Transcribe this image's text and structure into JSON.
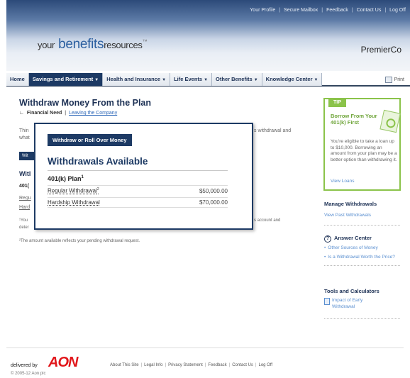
{
  "top_nav": [
    "Your Profile",
    "Secure Mailbox",
    "Feedback",
    "Contact Us",
    "Log Off"
  ],
  "logo": {
    "your": "your",
    "benefits": "benefits",
    "resources": "resources",
    "tm": "™"
  },
  "company": "PremierCo",
  "main_nav": {
    "tabs": [
      {
        "label": "Home"
      },
      {
        "label": "Savings and Retirement"
      },
      {
        "label": "Health and Insurance"
      },
      {
        "label": "Life Events"
      },
      {
        "label": "Other Benefits"
      },
      {
        "label": "Knowledge Center"
      }
    ],
    "print": "Print"
  },
  "page": {
    "title": "Withdraw Money From the Plan",
    "subnav_current": "Financial Need",
    "subnav_sep": "|",
    "subnav_link": "Leaving the Company"
  },
  "background": {
    "text1": "Thin",
    "text2": "what",
    "text3": "s withdrawal and",
    "btn": "Wit",
    "heading": "Witl",
    "r1": "401(",
    "r2": "Regu",
    "r3": "Hard",
    "fn1": "¹You",
    "fn1b": "deter",
    "fn1c": "s account and",
    "fn2": "²The amount available reflects your pending withdrawal request."
  },
  "overlay": {
    "button": "Withdraw or Roll Over Money",
    "title": "Withdrawals Available",
    "plan": "401(k) Plan",
    "plan_sup": "1",
    "rows": [
      {
        "label": "Regular Withdrawal",
        "sup": "2",
        "amount": "$50,000.00"
      },
      {
        "label": "Hardship Withdrawal",
        "sup": "",
        "amount": "$70,000.00"
      }
    ]
  },
  "tip": {
    "tab": "TIP",
    "heading": "Borrow From Your 401(k) First",
    "body": "You're eligible to take a loan up to $10,000. Borrowing an amount from your plan may be a better option than withdrawing it.",
    "link": "View Loans"
  },
  "sidebar": {
    "manage_heading": "Manage Withdrawals",
    "manage_link": "View Past Withdrawals",
    "answer_heading": "Answer Center",
    "answer_items": [
      "Other Sources of Money",
      "Is a Withdrawal Worth the Price?"
    ],
    "tools_heading": "Tools and Calculators",
    "tools_link": "Impact of Early Withdrawal"
  },
  "footer": {
    "delivered_by": "delivered by",
    "brand": "AON",
    "copyright": "© 2005-12 Aon plc",
    "links": [
      "About This Site",
      "Legal Info",
      "Privacy Statement",
      "Feedback",
      "Contact Us",
      "Log Off"
    ]
  },
  "colors": {
    "navy": "#1d3a64",
    "tip_green": "#8bc34a",
    "aon_red": "#e1161a",
    "link_blue": "#5a8fd0"
  }
}
